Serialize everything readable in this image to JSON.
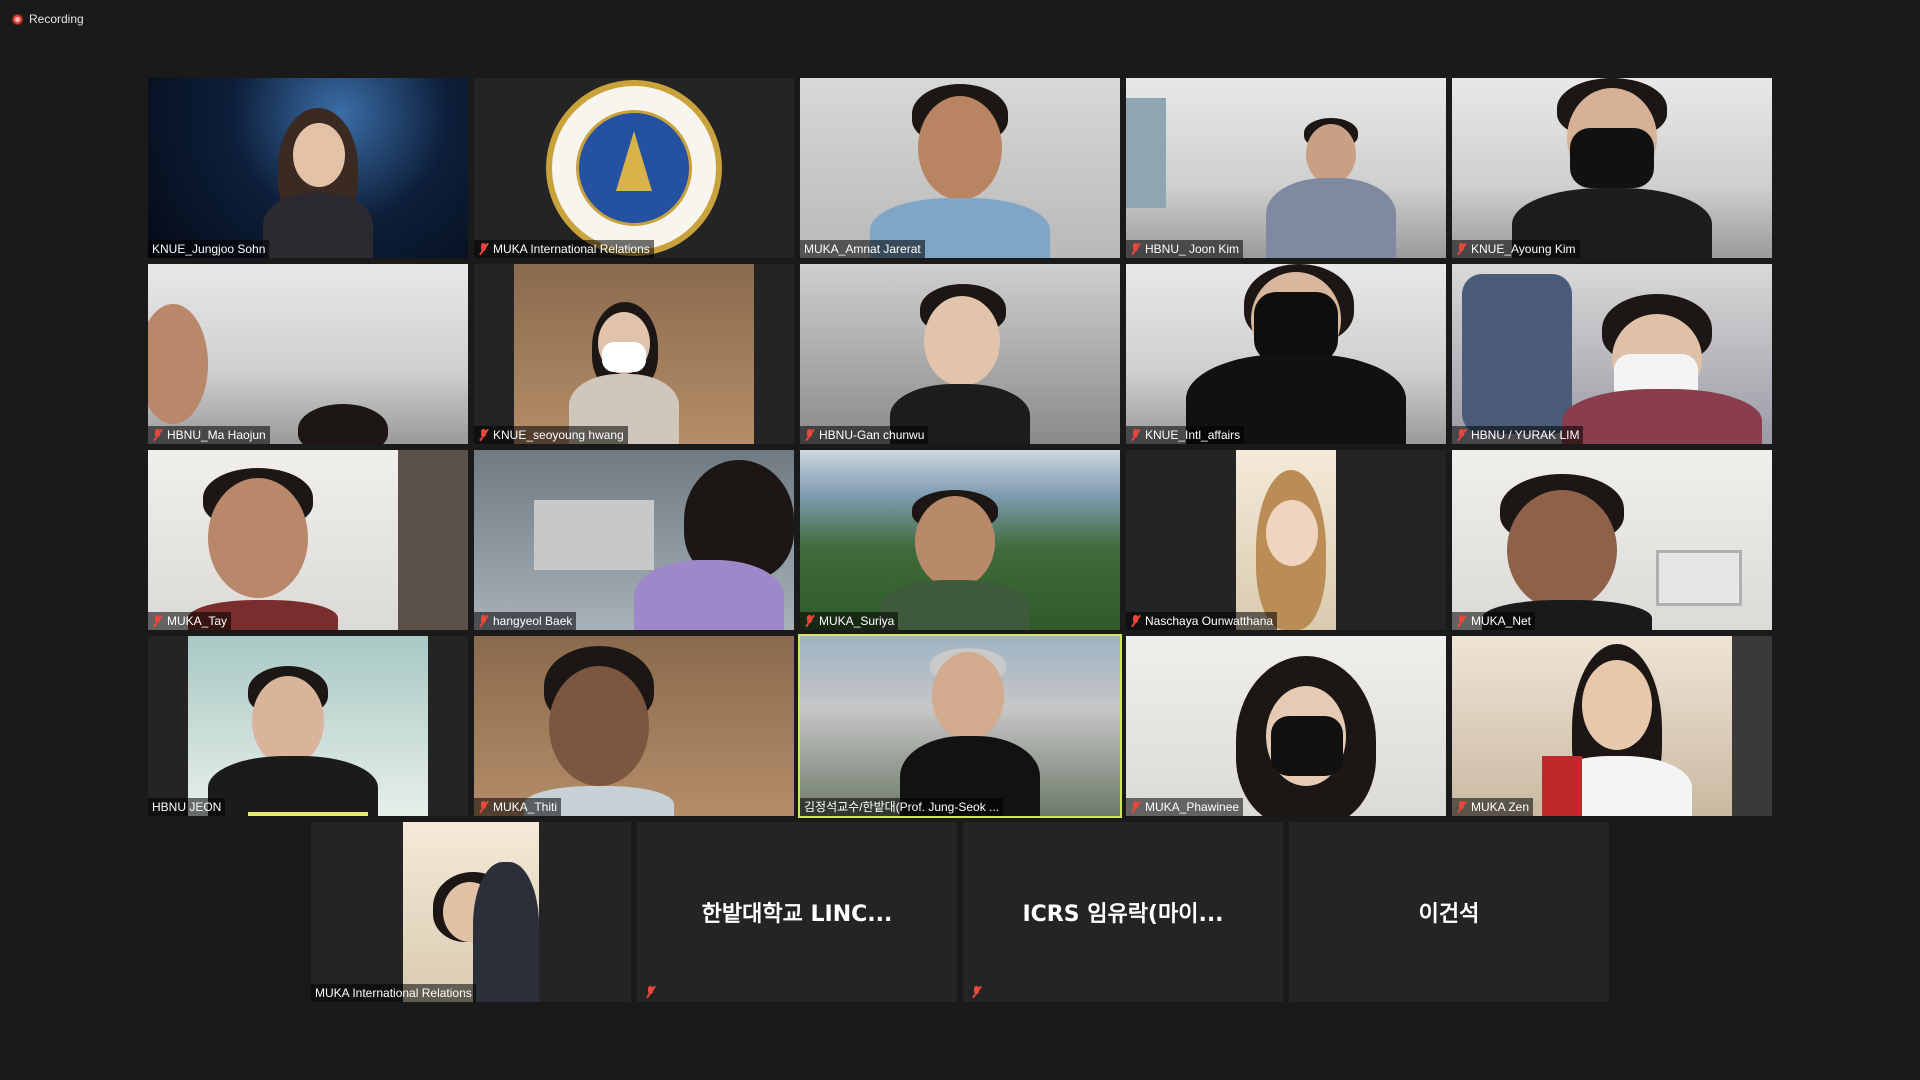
{
  "recording": {
    "label": "Recording"
  },
  "participants": [
    {
      "name": "KNUE_Jungjoo Sohn",
      "muted": false
    },
    {
      "name": "MUKA International Relations",
      "muted": true
    },
    {
      "name": "MUKA_Amnat Jarerat",
      "muted": false
    },
    {
      "name": "HBNU_ Joon Kim",
      "muted": true
    },
    {
      "name": "KNUE_Ayoung Kim",
      "muted": true
    },
    {
      "name": "HBNU_Ma Haojun",
      "muted": true
    },
    {
      "name": "KNUE_seoyoung hwang",
      "muted": true
    },
    {
      "name": "HBNU-Gan chunwu",
      "muted": true
    },
    {
      "name": "KNUE_Intl_affairs",
      "muted": true
    },
    {
      "name": "HBNU / YURAK LIM",
      "muted": true
    },
    {
      "name": "MUKA_Tay",
      "muted": true
    },
    {
      "name": "hangyeol Baek",
      "muted": true
    },
    {
      "name": "MUKA_Suriya",
      "muted": true
    },
    {
      "name": "Naschaya Ounwatthana",
      "muted": true
    },
    {
      "name": "MUKA_Net",
      "muted": true
    },
    {
      "name": "HBNU JEON",
      "muted": false
    },
    {
      "name": "MUKA_Thiti",
      "muted": true
    },
    {
      "name": "김정석교수/한밭대(Prof. Jung-Seok ...",
      "muted": false,
      "active_speaker": true
    },
    {
      "name": "MUKA_Phawinee",
      "muted": true
    },
    {
      "name": "MUKA Zen",
      "muted": true
    },
    {
      "name": "MUKA International Relations",
      "muted": false
    },
    {
      "name": "한밭대학교 LINC...",
      "muted": true,
      "video_off": true
    },
    {
      "name": "ICRS 임유락(마이...",
      "muted": true,
      "video_off": true
    },
    {
      "name": "이건석",
      "muted": false,
      "video_off": true
    }
  ],
  "colors": {
    "background": "#1a1a1a",
    "tile": "#242424",
    "active_speaker_border": "#cfe65a",
    "muted_icon": "#e8473b",
    "recording_dot": "#e0463a"
  }
}
